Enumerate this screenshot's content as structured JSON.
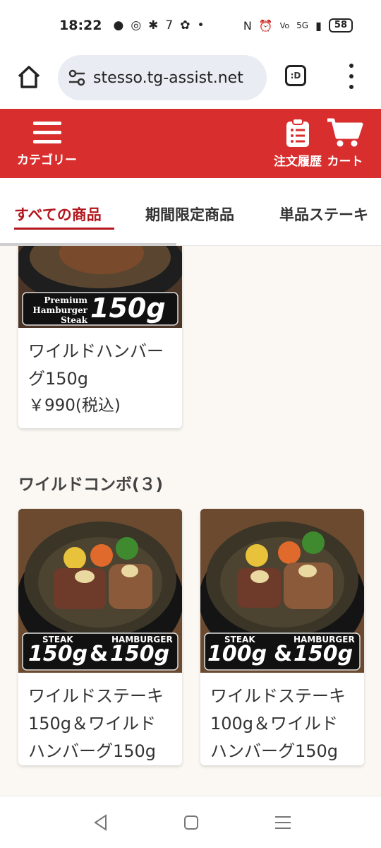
{
  "status_bar": {
    "time": "18:22",
    "battery": "58",
    "network": "5G"
  },
  "browser": {
    "url": "stesso.tg-assist.net",
    "tab_count": ":D"
  },
  "header": {
    "category_label": "カテゴリー",
    "history_label": "注文履歴",
    "cart_label": "カート"
  },
  "tabs": [
    {
      "label": "すべての商品",
      "active": true
    },
    {
      "label": "期間限定商品",
      "active": false
    },
    {
      "label": "単品ステーキ",
      "active": false
    }
  ],
  "top_card": {
    "name": "ワイルドハンバーグ150g",
    "price": "￥990(税込)",
    "badge_text_line1": "Premium",
    "badge_text_line2": "Hamburger",
    "badge_text_line3": "Steak",
    "badge_weight": "150g"
  },
  "section": {
    "title": "ワイルドコンボ(３)"
  },
  "combo_cards": [
    {
      "name": "ワイルドステーキ150g＆ワイルドハンバーグ150g",
      "label_left": "STEAK",
      "label_right": "HAMBURGER",
      "weight_left": "150g",
      "amp": "&",
      "weight_right": "150g"
    },
    {
      "name": "ワイルドステーキ100g＆ワイルドハンバーグ150g",
      "label_left": "STEAK",
      "label_right": "HAMBURGER",
      "weight_left": "100g",
      "amp": "&",
      "weight_right": "150g"
    }
  ],
  "colors": {
    "brand_red": "#d92e2e",
    "active_tab": "#b3161d",
    "background": "#fbf8f3"
  }
}
